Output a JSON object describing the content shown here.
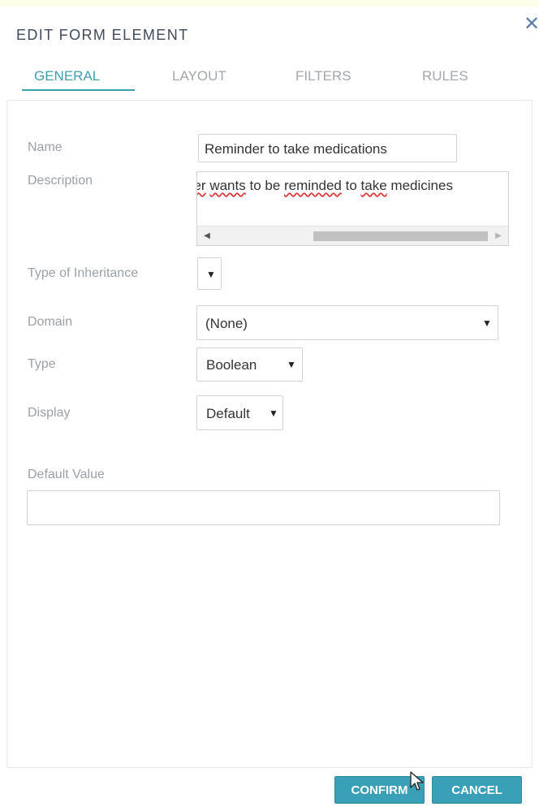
{
  "dialog": {
    "title": "EDIT FORM ELEMENT",
    "close_icon": "close-icon"
  },
  "tabs": [
    {
      "label": "GENERAL",
      "active": true
    },
    {
      "label": "LAYOUT",
      "active": false
    },
    {
      "label": "FILTERS",
      "active": false
    },
    {
      "label": "RULES",
      "active": false
    }
  ],
  "form": {
    "name": {
      "label": "Name",
      "value": "Reminder to take medications"
    },
    "description": {
      "label": "Description",
      "value_visible_prefix": "ger",
      "value_visible_words": [
        "wants",
        "to be",
        "reminded",
        "to",
        "take",
        "medicines"
      ]
    },
    "inheritance": {
      "label": "Type of Inheritance",
      "value": ""
    },
    "domain": {
      "label": "Domain",
      "value": "(None)"
    },
    "type": {
      "label": "Type",
      "value": "Boolean"
    },
    "display": {
      "label": "Display",
      "value": "Default"
    },
    "default_value": {
      "label": "Default Value",
      "value": ""
    }
  },
  "buttons": {
    "confirm": "CONFIRM",
    "cancel": "CANCEL"
  },
  "colors": {
    "accent": "#3f9fb0",
    "button": "#3aa0b8",
    "label": "#9aa1a8"
  }
}
